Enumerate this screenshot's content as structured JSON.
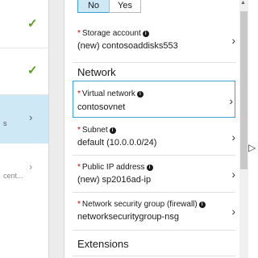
{
  "left_steps": {
    "step1": {
      "icon": "checkmark-icon",
      "check": "✓"
    },
    "step2": {
      "icon": "checkmark-icon",
      "check": "✓"
    },
    "step3": {
      "peek": "s",
      "chevron": "›"
    },
    "step4": {
      "peek": "cent...",
      "chevron": "›"
    }
  },
  "toggle": {
    "no": "No",
    "yes": "Yes",
    "selected": "No"
  },
  "fields": {
    "storage": {
      "label": "Storage account",
      "value": "(new) contosoaddisks553"
    },
    "vnet": {
      "label": "Virtual network",
      "value": "contosovnet"
    },
    "subnet": {
      "label": "Subnet",
      "value": "default (10.0.0.0/24)"
    },
    "pip": {
      "label": "Public IP address",
      "value": "(new) sp2016ad-ip"
    },
    "nsg": {
      "label": "Network security group (firewall)",
      "value": "networksecuritygroup-nsg"
    }
  },
  "sections": {
    "network": "Network",
    "extensions": "Extensions"
  },
  "glyphs": {
    "required": "*",
    "info": "i",
    "arrow": "›",
    "scroll_up": "▲",
    "cursor": "▷"
  },
  "colors": {
    "accent": "#3ba0d3",
    "selected_bg": "#cfe8f6",
    "check": "#5aa01e",
    "required": "#c20000"
  }
}
